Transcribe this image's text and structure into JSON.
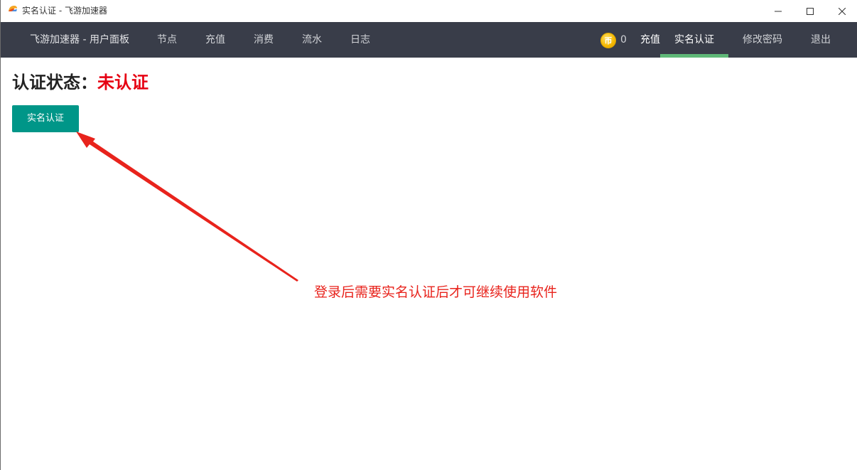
{
  "window": {
    "title": "实名认证 - 飞游加速器",
    "minimize_icon": "minimize-icon",
    "maximize_icon": "maximize-icon",
    "close_icon": "close-icon"
  },
  "nav": {
    "brand": "飞游加速器 - 用户面板",
    "items": [
      "节点",
      "充值",
      "消费",
      "流水",
      "日志"
    ],
    "coin_symbol": "币",
    "coin_count": "0",
    "recharge": "充值",
    "verify": "实名认证",
    "change_password": "修改密码",
    "logout": "退出",
    "active_color": "#5fb878",
    "background": "#393d49"
  },
  "main": {
    "status_label": "认证状态：",
    "status_value": "未认证",
    "status_value_color": "#e60012",
    "verify_button": "实名认证",
    "button_color": "#009688"
  },
  "annotation": {
    "text": "登录后需要实名认证后才可继续使用软件",
    "color": "#e8231c"
  }
}
